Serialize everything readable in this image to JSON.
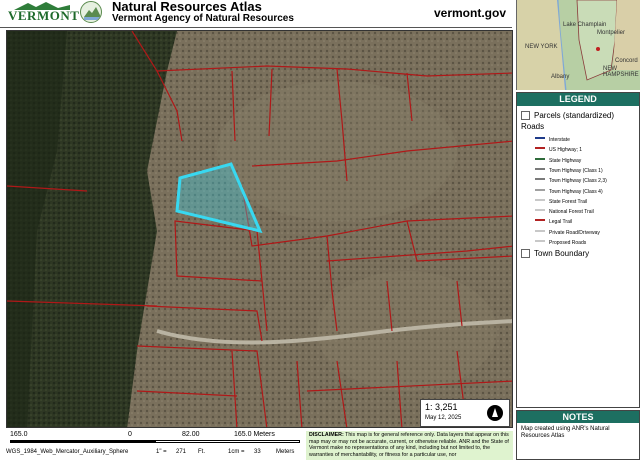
{
  "header": {
    "logo_text": "VERMONT",
    "title": "Natural Resources Atlas",
    "subtitle": "Vermont Agency of Natural Resources",
    "site": "vermont.gov"
  },
  "inset": {
    "labels": [
      "NEW YORK",
      "Lake Champlain",
      "Montpelier",
      "Concord",
      "NEW HAMPSHIRE",
      "Albany"
    ]
  },
  "map": {
    "scale_ratio": "1: 3,251",
    "date": "May 12, 2025"
  },
  "legend": {
    "heading": "LEGEND",
    "parcels": "Parcels (standardized)",
    "roads": "Roads",
    "items": [
      {
        "label": "Interstate",
        "color": "#1f3b8a"
      },
      {
        "label": "US Highway; 1",
        "color": "#b22222"
      },
      {
        "label": "State Highway",
        "color": "#2e6b3a"
      },
      {
        "label": "Town Highway (Class 1)",
        "color": "#7a7a7a"
      },
      {
        "label": "Town Highway (Class 2,3)",
        "color": "#7a7a7a"
      },
      {
        "label": "Town Highway (Class 4)",
        "color": "#a0a0a0"
      },
      {
        "label": "State Forest Trail",
        "color": "#c8c8c8"
      },
      {
        "label": "National Forest Trail",
        "color": "#c8c8c8"
      },
      {
        "label": "Legal Trail",
        "color": "#b22222"
      },
      {
        "label": "Private Road/Driveway",
        "color": "#c8c8c8"
      },
      {
        "label": "Proposed Roads",
        "color": "#c8c8c8"
      }
    ],
    "town_boundary": "Town Boundary"
  },
  "notes": {
    "heading": "NOTES",
    "text": "Map created using ANR's Natural Resources Atlas"
  },
  "footer": {
    "scale_left": "165.0",
    "scale_zero": "0",
    "scale_mid": "82.00",
    "scale_right": "165.0 Meters",
    "projection": "WGS_1984_Web_Mercator_Auxiliary_Sphere",
    "inch_label": "1\" =",
    "inch_value": "271",
    "inch_unit": "Ft.",
    "cm_label": "1cm =",
    "cm_value": "33",
    "cm_unit": "Meters",
    "disclaimer_title": "DISCLAIMER:",
    "disclaimer": "This map is for general reference only. Data layers that appear on this map may or may not be accurate, current, or otherwise reliable. ANR and the State of Vermont make no representations of any kind, including but not limited to, the warranties of merchantability, or fitness for a particular use, nor"
  },
  "colors": {
    "parcel_line": "#b01818",
    "selected_parcel": "#38d8f0",
    "legend_header": "#1d6f61"
  }
}
